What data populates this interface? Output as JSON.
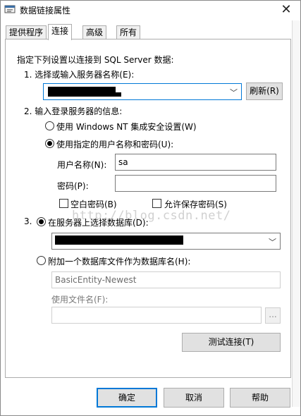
{
  "window": {
    "title": "数据链接属性",
    "close_glyph": "✕"
  },
  "tabs": [
    {
      "label": "提供程序"
    },
    {
      "label": "连接"
    },
    {
      "label": "高级"
    },
    {
      "label": "所有"
    }
  ],
  "connection": {
    "intro": "指定下列设置以连接到 SQL Server 数据:",
    "step1_label": "1. 选择或输入服务器名称(E):",
    "refresh_label": "刷新(R)",
    "step2_label": "2. 输入登录服务器的信息:",
    "radio_nt_label": "使用 Windows NT 集成安全设置(W)",
    "radio_specific_label": "使用指定的用户名称和密码(U):",
    "username_label": "用户名称(N):",
    "username_value": "sa",
    "password_label": "密码(P):",
    "password_value": "",
    "blank_password_label": "空白密码(B)",
    "allow_save_label": "允许保存密码(S)",
    "step3_prefix": "3.",
    "radio_select_db_label": "在服务器上选择数据库(D):",
    "radio_attach_label": "附加一个数据库文件作为数据库名(H):",
    "attach_db_value": "BasicEntity-Newest",
    "use_filename_label": "使用文件名(F):",
    "use_filename_value": "",
    "browse_label": "...",
    "test_label": "测试连接(T)"
  },
  "watermark": "http://blog.csdn.net/",
  "footer": {
    "ok_label": "确定",
    "cancel_label": "取消",
    "help_label": "帮助"
  },
  "icons": {
    "dropdown": "chevron-down-icon",
    "title": "database-link-icon"
  }
}
